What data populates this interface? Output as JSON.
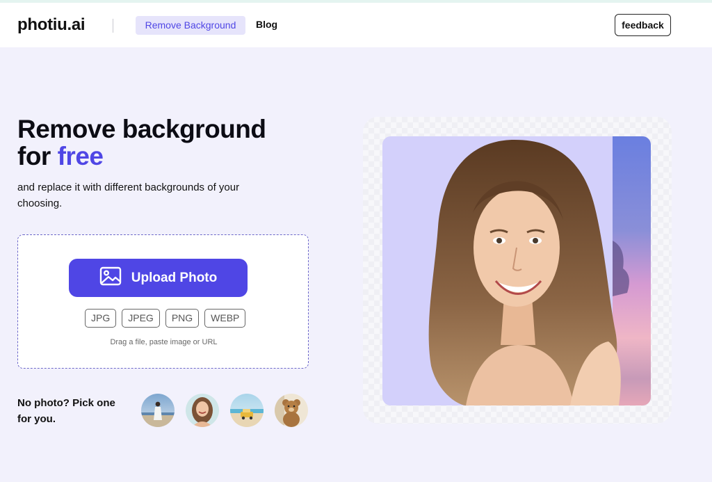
{
  "header": {
    "logo": "photiu.ai",
    "nav_active": "Remove Background",
    "nav_blog": "Blog",
    "feedback": "feedback"
  },
  "hero": {
    "title_line1": "Remove background",
    "title_line2_prefix": "for ",
    "title_line2_accent": "free",
    "subtitle": "and replace it with different backgrounds of your choosing."
  },
  "upload": {
    "button_label": "Upload Photo",
    "formats": [
      "JPG",
      "JPEG",
      "PNG",
      "WEBP"
    ],
    "hint": "Drag a file, paste image or URL"
  },
  "samples": {
    "label": "No photo? Pick one for you.",
    "items": [
      "beach-woman-sample",
      "portrait-woman-sample",
      "car-beach-sample",
      "teddy-bear-sample"
    ]
  },
  "colors": {
    "accent": "#4f46e5",
    "page_bg": "#f2f1fc",
    "nav_active_bg": "#e6e4fb"
  }
}
